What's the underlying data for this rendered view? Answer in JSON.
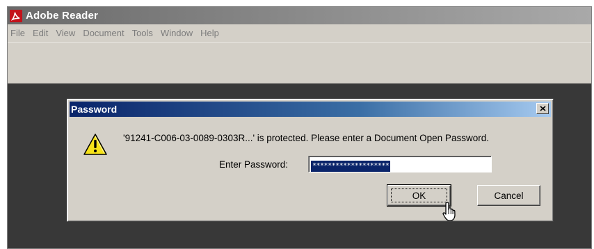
{
  "app": {
    "title": "Adobe Reader",
    "icon": "adobe-reader-logo-icon"
  },
  "menubar": {
    "items": [
      "File",
      "Edit",
      "View",
      "Document",
      "Tools",
      "Window",
      "Help"
    ]
  },
  "dialog": {
    "title": "Password",
    "close_icon": "close-icon",
    "warning_icon": "warning-icon",
    "message": "'91241-C006-03-0089-0303R...' is protected. Please enter a Document Open Password.",
    "password_label": "Enter Password:",
    "password_value": "********************",
    "ok_label": "OK",
    "cancel_label": "Cancel",
    "cursor": "hand-pointer-cursor"
  },
  "colors": {
    "dialog_titlebar": "#0a246a",
    "app_titlebar": "#6a6a6a",
    "document_area": "#383838",
    "chrome": "#d4d0c8",
    "selection": "#0a246a"
  }
}
